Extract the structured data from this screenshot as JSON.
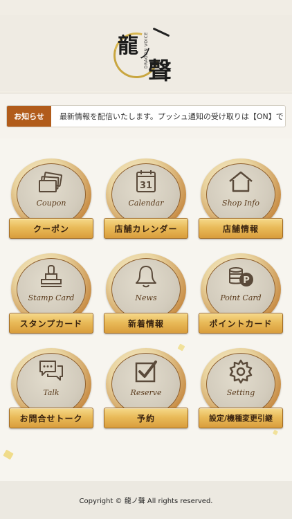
{
  "header": {
    "logo_kanji_1": "龍",
    "logo_kanji_2": "ノ",
    "logo_kanji_3": "聲",
    "logo_sub": "DRAGON VOICE"
  },
  "notice": {
    "label": "お知らせ",
    "text": "最新情報を配信いたします。プッシュ通知の受け取りは【ON】で"
  },
  "menu": [
    {
      "icon": "coupon-icon",
      "en": "Coupon",
      "ja": "クーポン"
    },
    {
      "icon": "calendar-icon",
      "en": "Calendar",
      "ja": "店舗カレンダー",
      "calendar_day": "31"
    },
    {
      "icon": "house-icon",
      "en": "Shop Info",
      "ja": "店舗情報"
    },
    {
      "icon": "stamp-icon",
      "en": "Stamp Card",
      "ja": "スタンプカード"
    },
    {
      "icon": "bell-icon",
      "en": "News",
      "ja": "新着情報"
    },
    {
      "icon": "coins-icon",
      "en": "Point Card",
      "ja": "ポイントカード",
      "coin_letter": "P"
    },
    {
      "icon": "chat-icon",
      "en": "Talk",
      "ja": "お問合せトーク"
    },
    {
      "icon": "checkbox-icon",
      "en": "Reserve",
      "ja": "予約"
    },
    {
      "icon": "gear-icon",
      "en": "Setting",
      "ja": "設定/機種変更引継"
    }
  ],
  "footer": {
    "copyright": "Copyright © 龍ノ聲 All rights reserved."
  },
  "colors": {
    "notice_label_bg": "#b15c1b",
    "wood_label": "#e9bb5a",
    "icon_stroke": "#5a4a3a"
  }
}
